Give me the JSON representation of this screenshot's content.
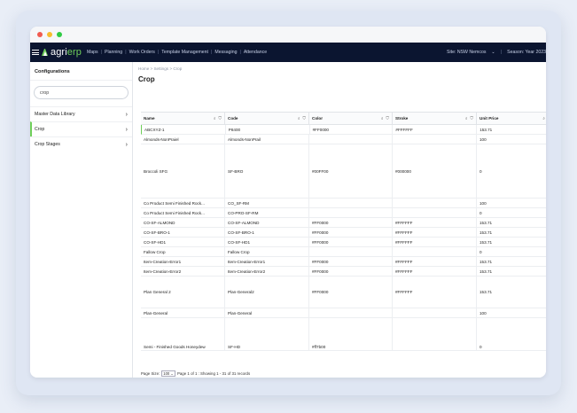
{
  "topnav": {
    "brand_prefix": "agri",
    "brand_suffix": "erp",
    "links": [
      "Maps",
      "Planning",
      "Work Orders",
      "Template Management",
      "Messaging",
      "Attendance"
    ],
    "site_label": "Site: NSW Nemcos",
    "chevron": "⌄",
    "separator": "|",
    "season_label": "Season: Year 2023"
  },
  "sidebar": {
    "title": "Configurations",
    "search_value": "crop",
    "items": [
      {
        "label": "Master Data Library"
      },
      {
        "label": "Crop"
      },
      {
        "label": "Crop Stages"
      }
    ]
  },
  "main": {
    "breadcrumb": "Home > Settings > Crop",
    "title": "Crop"
  },
  "grid": {
    "columns": [
      "Name",
      "Code",
      "Color",
      "Stroke",
      "Unit Price"
    ],
    "rows": [
      {
        "name": "ABCXYZ-1",
        "code": "P8400",
        "color": "#FF0000",
        "stroke": "#FFFFFF",
        "price": "153.71"
      },
      {
        "name": "Almonds-NonPraiel",
        "code": "Almonds-NonPrail",
        "color": "",
        "stroke": "",
        "price": "100"
      },
      {
        "name": "Broccoli SFG",
        "code": "SF-BRO",
        "color": "#00FF00",
        "stroke": "#000000",
        "price": "0"
      },
      {
        "name": "Co Product Semi Finished Rock...",
        "code": "CO_SF-RM",
        "color": "",
        "stroke": "",
        "price": "100"
      },
      {
        "name": "Co Product Semi Finished Rock...",
        "code": "CO-PRO-SF-RM",
        "color": "",
        "stroke": "",
        "price": "0"
      },
      {
        "name": "CO-SF-ALMOND",
        "code": "CO-SF-ALMOND",
        "color": "#FF0000",
        "stroke": "#FFFFFF",
        "price": "153.71"
      },
      {
        "name": "CO-SF-BRO-1",
        "code": "CO-SF-BRO-1",
        "color": "#FF0000",
        "stroke": "#FFFFFF",
        "price": "153.71"
      },
      {
        "name": "CO-SF-HD1",
        "code": "CO-SF-HD1",
        "color": "#FF0000",
        "stroke": "#FFFFFF",
        "price": "153.71"
      },
      {
        "name": "Fallow Crop",
        "code": "Fallow Crop",
        "color": "",
        "stroke": "",
        "price": "0"
      },
      {
        "name": "Item-Creation-Error1",
        "code": "Item-Creation-Error1",
        "color": "#FF0000",
        "stroke": "#FFFFFF",
        "price": "153.71"
      },
      {
        "name": "Item-Creation-Error2",
        "code": "Item-Creation-Error2",
        "color": "#FF0000",
        "stroke": "#FFFFFF",
        "price": "153.71"
      },
      {
        "name": "Plan General 2",
        "code": "Plan-General2",
        "color": "#FF0000",
        "stroke": "#FFFFFF",
        "price": "153.71"
      },
      {
        "name": "Plan-General",
        "code": "Plan-General",
        "color": "",
        "stroke": "",
        "price": "100"
      },
      {
        "name": "Semi - Finished Goods Honeydew",
        "code": "SF-HD",
        "color": "#ff7b00",
        "stroke": "",
        "price": "0"
      }
    ]
  },
  "footer": {
    "page_size_label": "Page Size:",
    "page_size_value": "100",
    "page_info": "Page 1 of 1 : Showing 1 - 31 of 31 records"
  },
  "colors": {
    "nav_bg": "#0b1530",
    "brand_green": "#6fcf5a"
  }
}
